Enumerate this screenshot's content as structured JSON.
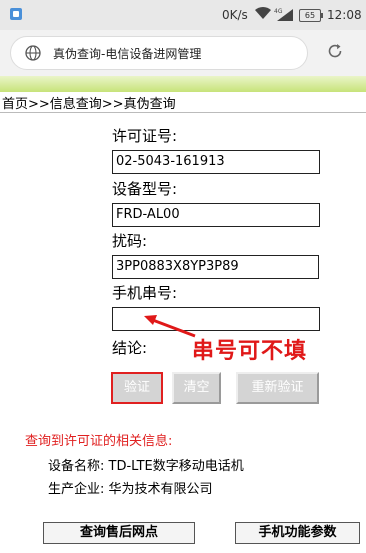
{
  "status_bar": {
    "network_speed": "0K/s",
    "signal_label": "4G",
    "battery": "65",
    "time": "12:08"
  },
  "browser": {
    "page_title": "真伪查询-电信设备进网管理"
  },
  "breadcrumb": "首页>>信息查询>>真伪查询",
  "form": {
    "license_label": "许可证号:",
    "license_value": "02-5043-161913",
    "model_label": "设备型号:",
    "model_value": "FRD-AL00",
    "code_label": "扰码:",
    "code_value": "3PP0883X8YP3P89",
    "serial_label": "手机串号:",
    "serial_value": "",
    "conclusion_label": "结论:"
  },
  "annotation": {
    "text": "串号可不填",
    "color": "#e01818"
  },
  "buttons": {
    "verify": "验证",
    "clear": "清空",
    "reverify": "重新验证"
  },
  "result": {
    "title": "查询到许可证的相关信息:",
    "device_name": "设备名称:  TD-LTE数字移动电话机",
    "manufacturer": "生产企业:  华为技术有限公司"
  },
  "bottom": {
    "service_points": "查询售后网点",
    "phone_params": "手机功能参数"
  }
}
